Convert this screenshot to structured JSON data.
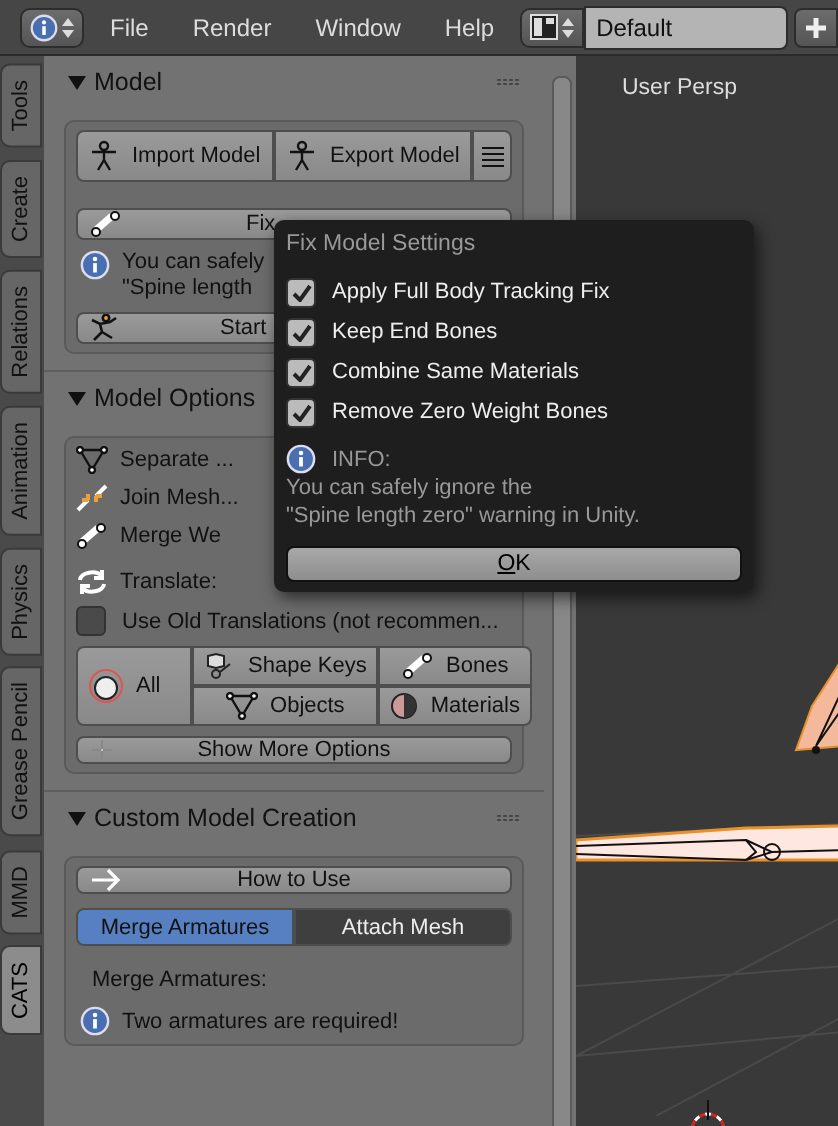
{
  "header": {
    "menus": [
      "File",
      "Render",
      "Window",
      "Help"
    ],
    "layout": "Default"
  },
  "side_tabs": [
    {
      "label": "Tools",
      "selected": false
    },
    {
      "label": "Create",
      "selected": false
    },
    {
      "label": "Relations",
      "selected": false
    },
    {
      "label": "Animation",
      "selected": false
    },
    {
      "label": "Physics",
      "selected": false
    },
    {
      "label": "Grease Pencil",
      "selected": false
    },
    {
      "label": "MMD",
      "selected": false
    },
    {
      "label": "CATS",
      "selected": true
    }
  ],
  "model": {
    "title": "Model",
    "expanded": true,
    "import": "Import Model",
    "export": "Export Model",
    "fix": "Fix",
    "info": [
      "You can safely",
      "\"Spine length"
    ],
    "start": "Start"
  },
  "model_options": {
    "title": "Model Options",
    "expanded": true,
    "operations": [
      "Separate ...",
      "Join Mesh...",
      "Merge We"
    ],
    "translate": "Translate:",
    "old_translations": {
      "label": "Use Old Translations (not recommen...",
      "checked": false
    },
    "all": "All",
    "buttons": [
      "Shape Keys",
      "Bones",
      "Objects",
      "Materials"
    ],
    "more": "Show More Options"
  },
  "custom": {
    "title": "Custom Model Creation",
    "expanded": true,
    "how_to": "How to Use",
    "tabs": [
      {
        "label": "Merge Armatures",
        "selected": true
      },
      {
        "label": "Attach Mesh",
        "selected": false
      }
    ],
    "label": "Merge Armatures:",
    "info": "Two armatures are required!"
  },
  "viewport": {
    "label": "User Persp"
  },
  "popup": {
    "title": "Fix Model Settings",
    "options": [
      {
        "label": "Apply Full Body Tracking Fix",
        "checked": true
      },
      {
        "label": "Keep End Bones",
        "checked": true
      },
      {
        "label": "Combine Same Materials",
        "checked": true
      },
      {
        "label": "Remove Zero Weight Bones",
        "checked": true
      }
    ],
    "info_title": "INFO:",
    "info_lines": [
      "You can safely ignore the",
      "\"Spine length zero\" warning in Unity."
    ],
    "ok": "OK"
  }
}
